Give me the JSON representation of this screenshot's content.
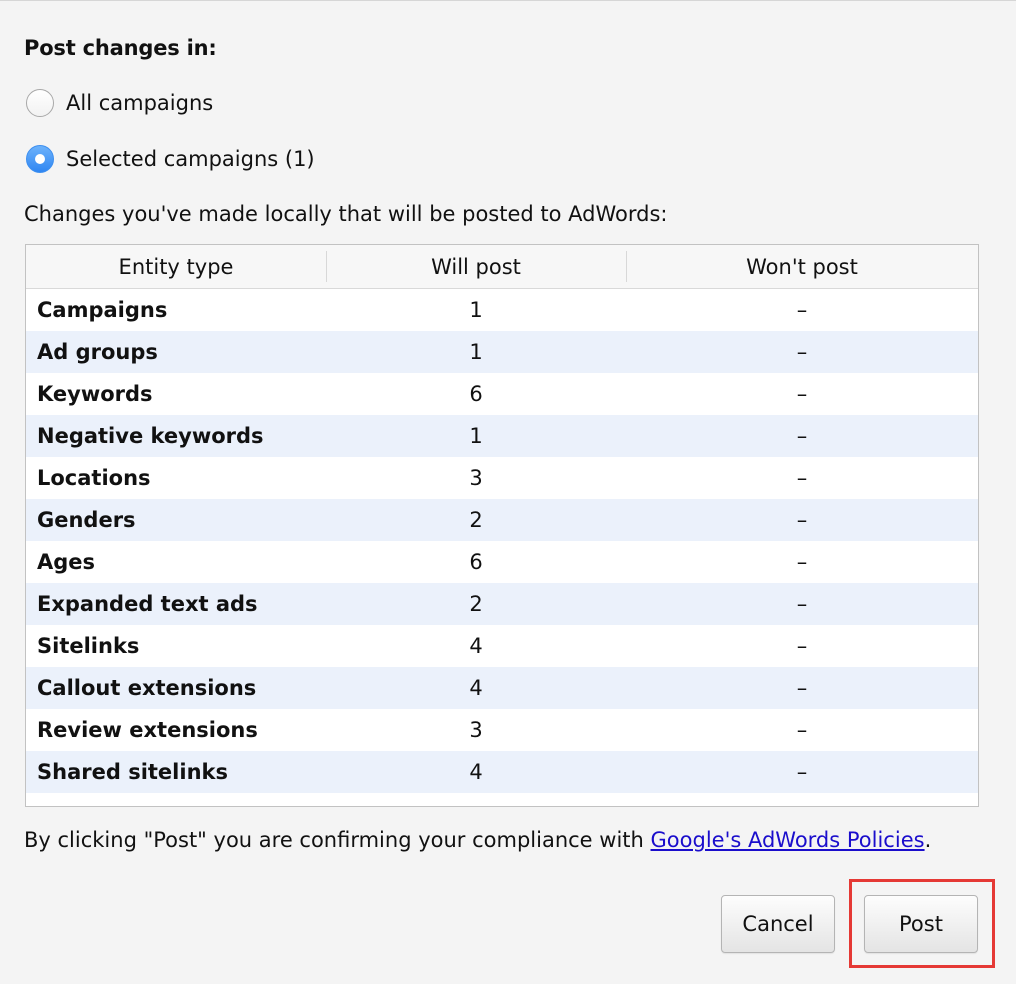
{
  "dialog": {
    "post_changes_label": "Post changes in:",
    "options": [
      {
        "label": "All campaigns",
        "selected": false
      },
      {
        "label": "Selected campaigns (1)",
        "selected": true
      }
    ],
    "changes_label": "Changes you've made locally that will be posted to AdWords:"
  },
  "table": {
    "headers": [
      "Entity type",
      "Will post",
      "Won't post"
    ],
    "rows": [
      {
        "entity": "Campaigns",
        "will_post": "1",
        "wont_post": "–"
      },
      {
        "entity": "Ad groups",
        "will_post": "1",
        "wont_post": "–"
      },
      {
        "entity": "Keywords",
        "will_post": "6",
        "wont_post": "–"
      },
      {
        "entity": "Negative keywords",
        "will_post": "1",
        "wont_post": "–"
      },
      {
        "entity": "Locations",
        "will_post": "3",
        "wont_post": "–"
      },
      {
        "entity": "Genders",
        "will_post": "2",
        "wont_post": "–"
      },
      {
        "entity": "Ages",
        "will_post": "6",
        "wont_post": "–"
      },
      {
        "entity": "Expanded text ads",
        "will_post": "2",
        "wont_post": "–"
      },
      {
        "entity": "Sitelinks",
        "will_post": "4",
        "wont_post": "–"
      },
      {
        "entity": "Callout extensions",
        "will_post": "4",
        "wont_post": "–"
      },
      {
        "entity": "Review extensions",
        "will_post": "3",
        "wont_post": "–"
      },
      {
        "entity": "Shared sitelinks",
        "will_post": "4",
        "wont_post": "–"
      }
    ]
  },
  "compliance": {
    "prefix": "By clicking \"Post\" you are confirming your compliance with ",
    "link": "Google's AdWords Policies",
    "suffix": "."
  },
  "buttons": {
    "cancel": "Cancel",
    "post": "Post"
  },
  "colors": {
    "highlight": "#e53935",
    "link": "#1a0dcc",
    "radio_selected": "#3d8ff0",
    "row_alt": "#ebf1fb"
  }
}
